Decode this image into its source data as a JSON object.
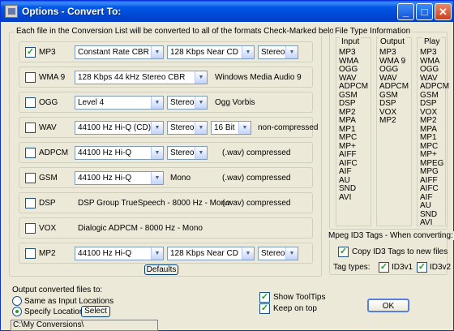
{
  "window": {
    "title": "Options - Convert To:",
    "min": "_",
    "max": "□",
    "close": "✕"
  },
  "conversion": {
    "legend": "Each file in the Conversion List will be converted to all of the formats Check-Marked below",
    "rows": [
      {
        "name": "MP3",
        "checked": true,
        "combo1": "Constant Rate CBR",
        "combo2": "128 Kbps  Near CD",
        "combo3": "Stereo",
        "note": ""
      },
      {
        "name": "WMA 9",
        "checked": false,
        "combo1": "128 Kbps 44 kHz Stereo CBR",
        "note": "Windows Media Audio 9"
      },
      {
        "name": "OGG",
        "checked": false,
        "combo1": "Level  4",
        "combo2": "Stereo",
        "note": "Ogg Vorbis"
      },
      {
        "name": "WAV",
        "checked": false,
        "combo1": "44100 Hz  Hi-Q (CD)",
        "combo2": "Stereo",
        "combo3": "16 Bit",
        "note": "non-compressed"
      },
      {
        "name": "ADPCM",
        "checked": false,
        "combo1": "44100 Hz  Hi-Q",
        "combo2": "Stereo",
        "note": "(.wav) compressed"
      },
      {
        "name": "GSM",
        "checked": false,
        "combo1": "44100 Hz  Hi-Q",
        "text1": "Mono",
        "note": "(.wav) compressed"
      },
      {
        "name": "DSP",
        "checked": false,
        "text1": "DSP Group TrueSpeech - 8000 Hz - Mono",
        "note": "(.wav) compressed"
      },
      {
        "name": "VOX",
        "checked": false,
        "text1": "Dialogic ADPCM - 8000 Hz - Mono"
      },
      {
        "name": "MP2",
        "checked": false,
        "combo1": "44100 Hz  Hi-Q",
        "combo2": "128 Kbps  Near CD",
        "combo3": "Stereo"
      }
    ],
    "defaults_label": "Defaults"
  },
  "filetype": {
    "legend": "File Type Information",
    "input_header": "Input",
    "output_header": "Output",
    "play_header": "Play",
    "input": [
      "MP3",
      "WMA",
      "OGG",
      "WAV",
      "ADPCM",
      "GSM",
      "DSP",
      "MP2",
      "MPA",
      "MP1",
      "MPC",
      "MP+",
      "AIFF",
      "AIFC",
      "AIF",
      "AU",
      "SND",
      "AVI"
    ],
    "output": [
      "MP3",
      "WMA 9",
      "OGG",
      "WAV",
      "ADPCM",
      "GSM",
      "DSP",
      "VOX",
      "MP2"
    ],
    "play": [
      "MP3",
      "WMA",
      "OGG",
      "WAV",
      "ADPCM",
      "GSM",
      "DSP",
      "VOX",
      "MP2",
      "MPA",
      "MP1",
      "MPC",
      "MP+",
      "MPEG",
      "MPG",
      "AIFF",
      "AIFC",
      "AIF",
      "AU",
      "SND",
      "AVI"
    ]
  },
  "id3": {
    "legend": "Mpeg ID3 Tags - When converting:",
    "copy_label": "Copy ID3 Tags to new files",
    "tag_types_label": "Tag types:",
    "v1_label": "ID3v1",
    "v2_label": "ID3v2"
  },
  "output": {
    "heading": "Output converted files to:",
    "same_label": "Same as Input Locations",
    "specify_label": "Specify Location",
    "select_label": "Select",
    "path": "C:\\My Conversions\\"
  },
  "options": {
    "tooltips_label": "Show ToolTips",
    "ontop_label": "Keep on top"
  },
  "ok_label": "OK",
  "check_mark": "✓",
  "arrow": "▼"
}
